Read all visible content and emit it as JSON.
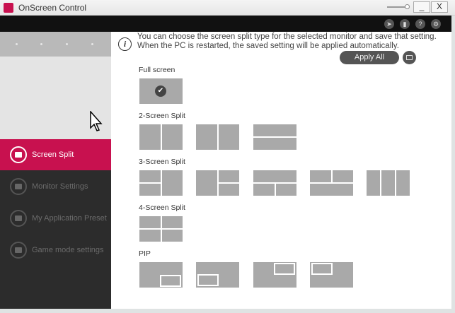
{
  "window": {
    "title": "OnScreen Control",
    "minimize": "_",
    "close": "X"
  },
  "toolbar": {
    "icons": [
      "cursor-icon",
      "monitor-icon",
      "help-icon",
      "gear-icon"
    ],
    "help_glyph": "?"
  },
  "sidebar": {
    "items": [
      {
        "label": "Screen Split",
        "active": true
      },
      {
        "label": "Monitor Settings"
      },
      {
        "label": "My Application Preset"
      },
      {
        "label": "Game mode settings"
      }
    ]
  },
  "main": {
    "info_line1": "You can choose the screen split type for the selected monitor and save that setting.",
    "info_line2": "When the PC is restarted, the saved setting will be applied automatically.",
    "info_glyph": "i",
    "apply_all": "Apply All",
    "sections": [
      "Full screen",
      "2-Screen Split",
      "3-Screen Split",
      "4-Screen Split",
      "PIP"
    ],
    "selected_check": "✔"
  },
  "colors": {
    "accent": "#c8114f",
    "sidebar": "#2c2c2c",
    "thumb": "#a9a9a9"
  }
}
